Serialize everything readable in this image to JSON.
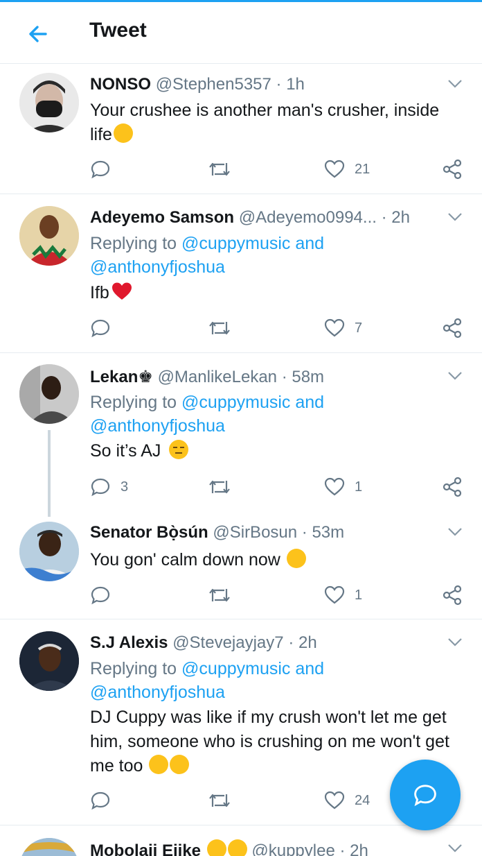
{
  "header": {
    "title": "Tweet",
    "back_icon": "arrow-left-icon"
  },
  "accent_color": "#1da1f2",
  "tweets": [
    {
      "name": "NONSO",
      "handle": "@Stephen5357",
      "time": "· 1h",
      "text": "Your crushee is another man's crusher, inside life",
      "emojis": [
        "laughing-tears-emoji"
      ],
      "replies": "",
      "retweets": "",
      "likes": "21"
    },
    {
      "name": "Adeyemo Samson",
      "handle": "@Adeyemo0994...",
      "time": "· 2h",
      "replying_prefix": "Replying to",
      "replying_line1": "@cuppymusic and",
      "replying_line2": "@anthonyfjoshua",
      "text": "Ifb",
      "emojis": [
        "red-heart-emoji"
      ],
      "replies": "",
      "retweets": "",
      "likes": "7"
    },
    {
      "name": "Lekan♚",
      "handle": "@ManlikeLekan",
      "time": "· 58m",
      "replying_prefix": "Replying to",
      "replying_line1": "@cuppymusic and",
      "replying_line2": "@anthonyfjoshua",
      "text": "So it’s AJ",
      "emojis": [
        "expressionless-face-emoji"
      ],
      "replies": "3",
      "retweets": "",
      "likes": "1"
    },
    {
      "name": "Senator Bọ̀sún",
      "handle": "@SirBosun",
      "time": "· 53m",
      "text": "You gon' calm down now",
      "emojis": [
        "laughing-tears-emoji"
      ],
      "replies": "",
      "retweets": "",
      "likes": "1"
    },
    {
      "name": "S.J Alexis",
      "handle": "@Stevejayjay7",
      "time": "· 2h",
      "replying_prefix": "Replying to",
      "replying_line1": "@cuppymusic and",
      "replying_line2": "@anthonyfjoshua",
      "text": "DJ Cuppy was like if my crush won't let me get him, someone who is crushing on me won't get me too",
      "emojis": [
        "crying-face-emoji",
        "loudly-crying-emoji"
      ],
      "replies": "",
      "retweets": "",
      "likes": "24"
    },
    {
      "name": "Mobolaji Ejike",
      "handle": "@kuppylee",
      "time": "· 2h",
      "emojis": [
        "sweat-smile-emoji",
        "sunglasses-emoji"
      ]
    }
  ],
  "fab": {
    "icon": "compose-reply-icon"
  }
}
